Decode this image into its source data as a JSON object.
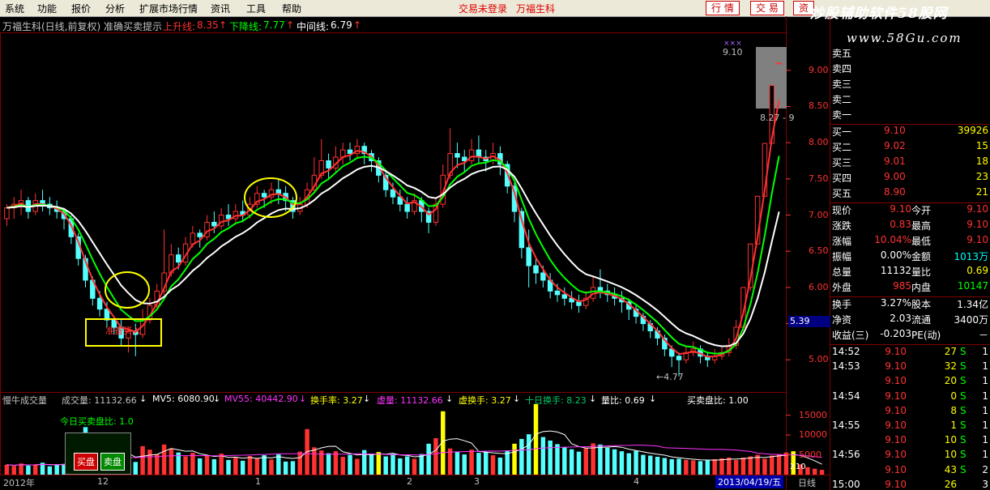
{
  "menu": {
    "items": [
      "系统",
      "功能",
      "报价",
      "分析",
      "扩展市场行情",
      "资讯",
      "工具",
      "帮助"
    ]
  },
  "trade": {
    "status": "交易未登录",
    "stock": "万福生科",
    "btn_quote": "行 情",
    "btn_trade": "交 易",
    "btn_extra": "资"
  },
  "watermark": {
    "line1": "炒股辅助软件58股网",
    "line2": "www.58Gu.com"
  },
  "indicator": {
    "title": "万福生科(日线,前复权) 准确买卖提示",
    "rise_label": "上升线:",
    "rise_val": "8.35",
    "fall_label": "下降线:",
    "fall_val": "7.77",
    "mid_label": "中间线:",
    "mid_val": "6.79"
  },
  "annotations": {
    "buy_text": "准备买入",
    "low_label": "4.77",
    "high_label": "9.10",
    "range_label": "8.27 - 9",
    "price_marker": "5.39",
    "top_arrows": "×××"
  },
  "volume_indicators": {
    "name": "慢牛成交量",
    "vol": "成交量: 11132.66",
    "mv5": "MV5: 6080.90",
    "mv55": "MV55: 40442.90",
    "turnover": "换手率: 3.27",
    "virtual_vol": "虚量: 11132.66",
    "virtual_turn": "虚换手: 3.27",
    "ten_turn": "十日换手: 8.23",
    "vol_ratio": "量比: 0.69",
    "buy_sell_ratio": "买卖盘比: 1.00",
    "today_ratio": "今日买卖盘比: 1.0",
    "buy_btn": "买盘",
    "sell_btn": "卖盘",
    "multiplier": "X10"
  },
  "price_axis": [
    "9.00",
    "8.50",
    "8.00",
    "7.50",
    "7.00",
    "6.50",
    "6.00",
    "5.50",
    "5.00"
  ],
  "volume_axis": [
    "15000",
    "10000",
    "5000"
  ],
  "date_axis": {
    "year": "2012年",
    "labels": [
      "12",
      "1",
      "2",
      "3",
      "4"
    ],
    "current_date": "2013/04/19/五",
    "period": "日线"
  },
  "colors": {
    "up": "#ff3232",
    "down": "#54ffff",
    "rise_line": "#ff3232",
    "fall_line": "#00ff00",
    "mid_line": "#ffffff",
    "yellow": "#ffff00"
  },
  "quote": {
    "sell": [
      {
        "label": "卖五"
      },
      {
        "label": "卖四"
      },
      {
        "label": "卖三"
      },
      {
        "label": "卖二"
      },
      {
        "label": "卖一"
      }
    ],
    "buy": [
      {
        "label": "买一",
        "price": "9.10",
        "vol": "39926"
      },
      {
        "label": "买二",
        "price": "9.02",
        "vol": "15"
      },
      {
        "label": "买三",
        "price": "9.01",
        "vol": "18"
      },
      {
        "label": "买四",
        "price": "9.00",
        "vol": "23"
      },
      {
        "label": "买五",
        "price": "8.90",
        "vol": "21"
      }
    ],
    "stats": [
      {
        "l1": "现价",
        "v1": "9.10",
        "l2": "今开",
        "v2": "9.10"
      },
      {
        "l1": "涨跌",
        "v1": "0.83",
        "l2": "最高",
        "v2": "9.10"
      },
      {
        "l1": "涨幅",
        "v1": "10.04%",
        "l2": "最低",
        "v2": "9.10"
      },
      {
        "l1": "振幅",
        "v1": "0.00%",
        "l2": "金额",
        "v2": "1013万"
      },
      {
        "l1": "总量",
        "v1": "11132",
        "l2": "量比",
        "v2": "0.69"
      },
      {
        "l1": "外盘",
        "v1": "985",
        "l2": "内盘",
        "v2": "10147"
      }
    ],
    "stats2": [
      {
        "l1": "换手",
        "v1": "3.27%",
        "l2": "股本",
        "v2": "1.34亿"
      },
      {
        "l1": "净资",
        "v1": "2.03",
        "l2": "流通",
        "v2": "3400万"
      },
      {
        "l1": "收益(三)",
        "v1": "-0.203",
        "l2": "PE(动)",
        "v2": "－"
      }
    ],
    "ticks": [
      {
        "time": "14:52",
        "price": "9.10",
        "vol": "27",
        "dir": "S",
        "n": "1"
      },
      {
        "time": "14:53",
        "price": "9.10",
        "vol": "32",
        "dir": "S",
        "n": "1"
      },
      {
        "time": "",
        "price": "9.10",
        "vol": "20",
        "dir": "S",
        "n": "1"
      },
      {
        "time": "14:54",
        "price": "9.10",
        "vol": "0",
        "dir": "S",
        "n": "1"
      },
      {
        "time": "",
        "price": "9.10",
        "vol": "8",
        "dir": "S",
        "n": "1"
      },
      {
        "time": "14:55",
        "price": "9.10",
        "vol": "1",
        "dir": "S",
        "n": "1"
      },
      {
        "time": "",
        "price": "9.10",
        "vol": "10",
        "dir": "S",
        "n": "1"
      },
      {
        "time": "14:56",
        "price": "9.10",
        "vol": "10",
        "dir": "S",
        "n": "1"
      },
      {
        "time": "",
        "price": "9.10",
        "vol": "43",
        "dir": "S",
        "n": "2"
      },
      {
        "time": "15:00",
        "price": "9.10",
        "vol": "26",
        "dir": "",
        "n": "3"
      }
    ]
  },
  "chart_data": {
    "type": "candlestick",
    "price_range": [
      4.6,
      9.3
    ],
    "volume_range": [
      0,
      18000
    ],
    "candles": [
      [
        6.95,
        7.1,
        6.85,
        7.15
      ],
      [
        7.1,
        7.15,
        6.95,
        7.25
      ],
      [
        7.15,
        7.2,
        7.0,
        7.35
      ],
      [
        7.2,
        7.05,
        6.95,
        7.25
      ],
      [
        7.05,
        7.2,
        7.0,
        7.3
      ],
      [
        7.2,
        7.15,
        7.05,
        7.35
      ],
      [
        7.15,
        7.1,
        7.0,
        7.25
      ],
      [
        7.1,
        7.05,
        6.95,
        7.2
      ],
      [
        7.05,
        6.95,
        6.8,
        7.1
      ],
      [
        6.95,
        6.7,
        6.6,
        7.0
      ],
      [
        6.7,
        6.4,
        6.3,
        6.75
      ],
      [
        6.4,
        6.1,
        6.0,
        6.45
      ],
      [
        6.1,
        5.85,
        5.75,
        6.15
      ],
      [
        5.85,
        5.7,
        5.6,
        5.95
      ],
      [
        5.7,
        5.55,
        5.45,
        5.8
      ],
      [
        5.55,
        5.45,
        5.35,
        5.6
      ],
      [
        5.45,
        5.3,
        5.2,
        5.55
      ],
      [
        5.3,
        5.4,
        5.1,
        5.45
      ],
      [
        5.4,
        5.35,
        5.05,
        5.5
      ],
      [
        5.35,
        5.55,
        5.3,
        5.7
      ],
      [
        5.55,
        5.75,
        5.5,
        5.85
      ],
      [
        5.75,
        5.95,
        5.7,
        6.05
      ],
      [
        5.95,
        6.2,
        5.9,
        6.8
      ],
      [
        6.2,
        6.45,
        6.15,
        6.6
      ],
      [
        6.45,
        6.35,
        6.25,
        6.55
      ],
      [
        6.35,
        6.6,
        6.3,
        6.7
      ],
      [
        6.6,
        6.75,
        6.55,
        6.85
      ],
      [
        6.75,
        6.7,
        6.55,
        6.8
      ],
      [
        6.7,
        6.9,
        6.65,
        7.0
      ],
      [
        6.9,
        6.85,
        6.75,
        7.05
      ],
      [
        6.85,
        7.0,
        6.8,
        7.1
      ],
      [
        7.0,
        6.95,
        6.85,
        7.15
      ],
      [
        6.95,
        7.05,
        6.9,
        7.15
      ],
      [
        7.05,
        7.0,
        6.9,
        7.2
      ],
      [
        7.0,
        7.15,
        6.95,
        7.25
      ],
      [
        7.15,
        7.3,
        7.1,
        7.4
      ],
      [
        7.3,
        7.25,
        7.1,
        7.35
      ],
      [
        7.25,
        7.35,
        7.15,
        7.45
      ],
      [
        7.35,
        7.3,
        7.15,
        7.5
      ],
      [
        7.3,
        7.2,
        7.05,
        7.4
      ],
      [
        7.2,
        7.05,
        6.95,
        7.25
      ],
      [
        7.05,
        7.15,
        7.0,
        7.25
      ],
      [
        7.15,
        7.35,
        7.1,
        7.45
      ],
      [
        7.35,
        7.55,
        7.3,
        7.8
      ],
      [
        7.55,
        7.75,
        7.5,
        8.05
      ],
      [
        7.75,
        7.65,
        7.5,
        7.85
      ],
      [
        7.65,
        7.8,
        7.6,
        7.95
      ],
      [
        7.8,
        7.9,
        7.7,
        8.0
      ],
      [
        7.9,
        7.85,
        7.75,
        8.0
      ],
      [
        7.85,
        7.95,
        7.8,
        8.05
      ],
      [
        7.95,
        7.85,
        7.7,
        8.0
      ],
      [
        7.85,
        7.75,
        7.6,
        7.9
      ],
      [
        7.75,
        7.55,
        7.45,
        7.8
      ],
      [
        7.55,
        7.35,
        7.25,
        7.6
      ],
      [
        7.35,
        7.25,
        7.15,
        7.45
      ],
      [
        7.25,
        7.15,
        7.05,
        7.35
      ],
      [
        7.15,
        7.05,
        6.95,
        7.25
      ],
      [
        7.05,
        7.2,
        7.0,
        7.3
      ],
      [
        7.2,
        7.05,
        6.9,
        7.25
      ],
      [
        7.05,
        6.9,
        6.75,
        7.1
      ],
      [
        6.9,
        7.15,
        6.85,
        7.25
      ],
      [
        7.15,
        7.55,
        7.1,
        7.7
      ],
      [
        7.55,
        7.85,
        7.5,
        8.2
      ],
      [
        7.85,
        7.8,
        7.65,
        8.0
      ],
      [
        7.8,
        7.75,
        7.6,
        7.9
      ],
      [
        7.75,
        7.9,
        7.7,
        8.05
      ],
      [
        7.9,
        7.8,
        7.7,
        8.1
      ],
      [
        7.8,
        7.75,
        7.6,
        7.9
      ],
      [
        7.75,
        7.85,
        7.7,
        8.0
      ],
      [
        7.85,
        7.7,
        7.55,
        7.95
      ],
      [
        7.7,
        7.4,
        7.3,
        7.75
      ],
      [
        7.4,
        7.05,
        6.9,
        7.45
      ],
      [
        7.05,
        6.55,
        6.4,
        7.1
      ],
      [
        6.55,
        6.3,
        6.0,
        6.8
      ],
      [
        6.3,
        6.2,
        6.05,
        6.4
      ],
      [
        6.2,
        6.1,
        6.0,
        6.3
      ],
      [
        6.1,
        5.95,
        5.85,
        6.2
      ],
      [
        5.95,
        5.9,
        5.8,
        6.05
      ],
      [
        5.9,
        5.85,
        5.75,
        6.0
      ],
      [
        5.85,
        5.8,
        5.7,
        5.95
      ],
      [
        5.8,
        5.75,
        5.65,
        5.9
      ],
      [
        5.75,
        5.85,
        5.7,
        5.95
      ],
      [
        5.85,
        6.0,
        5.8,
        6.15
      ],
      [
        6.0,
        5.95,
        5.85,
        6.25
      ],
      [
        5.95,
        5.9,
        5.8,
        6.05
      ],
      [
        5.9,
        5.85,
        5.75,
        6.0
      ],
      [
        5.85,
        5.8,
        5.65,
        5.95
      ],
      [
        5.8,
        5.7,
        5.55,
        5.85
      ],
      [
        5.7,
        5.6,
        5.5,
        5.75
      ],
      [
        5.6,
        5.5,
        5.4,
        5.65
      ],
      [
        5.5,
        5.4,
        5.3,
        5.55
      ],
      [
        5.4,
        5.3,
        5.2,
        5.45
      ],
      [
        5.3,
        5.15,
        5.05,
        5.35
      ],
      [
        5.15,
        5.05,
        4.9,
        5.2
      ],
      [
        5.05,
        5.0,
        4.77,
        5.1
      ],
      [
        5.0,
        5.1,
        4.95,
        5.2
      ],
      [
        5.1,
        5.15,
        5.05,
        5.25
      ],
      [
        5.15,
        5.05,
        4.95,
        5.2
      ],
      [
        5.05,
        5.0,
        4.9,
        5.1
      ],
      [
        5.0,
        5.05,
        4.95,
        5.15
      ],
      [
        5.05,
        5.1,
        5.0,
        5.2
      ],
      [
        5.1,
        5.2,
        5.05,
        5.3
      ],
      [
        5.2,
        5.45,
        5.15,
        5.55
      ],
      [
        5.45,
        6.0,
        5.4,
        6.0
      ],
      [
        6.0,
        6.6,
        5.95,
        6.6
      ],
      [
        6.6,
        7.26,
        6.6,
        7.26
      ],
      [
        7.26,
        7.99,
        7.26,
        7.99
      ],
      [
        7.99,
        8.79,
        7.99,
        8.79
      ],
      [
        9.1,
        9.1,
        9.1,
        9.1
      ]
    ],
    "volume": [
      2500,
      2200,
      2800,
      2300,
      2600,
      3000,
      2100,
      2500,
      2700,
      2400,
      4500,
      12000,
      9500,
      8000,
      6000,
      5000,
      4300,
      3600,
      3200,
      7200,
      6300,
      5200,
      7600,
      6600,
      5600,
      4600,
      5500,
      4100,
      4800,
      3900,
      5300,
      3700,
      4400,
      3500,
      4700,
      4200,
      4900,
      3800,
      5100,
      3300,
      3400,
      5800,
      11500,
      6900,
      6100,
      5400,
      5900,
      4500,
      5000,
      4000,
      6200,
      5300,
      5700,
      4600,
      5200,
      4100,
      4600,
      4000,
      5200,
      7800,
      9200,
      16000,
      6600,
      5800,
      5100,
      6300,
      5500,
      5700,
      4900,
      4300,
      6100,
      7800,
      9000,
      10200,
      17800,
      9500,
      8600,
      7700,
      6900,
      6400,
      5800,
      6700,
      7900,
      7600,
      6800,
      6400,
      5900,
      5400,
      6000,
      5000,
      4800,
      4500,
      4200,
      3900,
      4000,
      3700,
      3600,
      3400,
      3700,
      3900,
      4100,
      4300,
      3700,
      4300,
      4600,
      5000,
      4000,
      4800,
      5200,
      5600,
      5900,
      2600,
      1900,
      1500,
      1200
    ],
    "highlight_volume_indices": [
      52,
      61,
      71,
      74,
      110
    ]
  }
}
